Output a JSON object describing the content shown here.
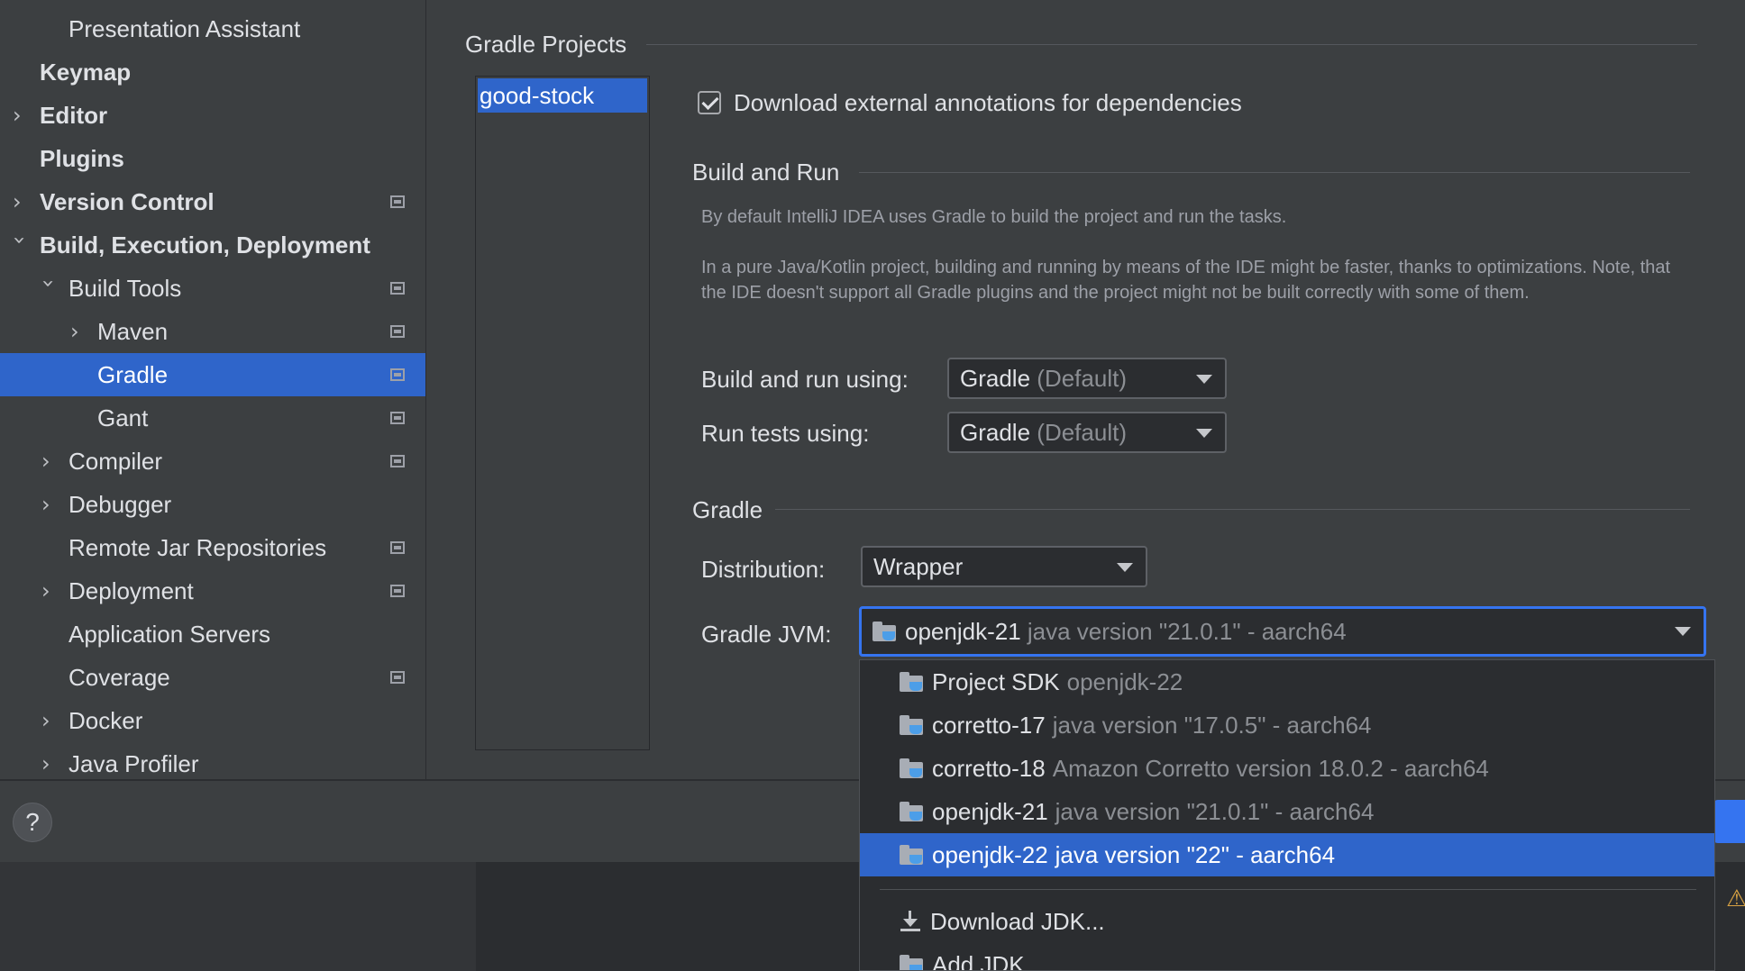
{
  "sidebar": {
    "items": [
      {
        "label": "Presentation Assistant"
      },
      {
        "label": "Keymap"
      },
      {
        "label": "Editor"
      },
      {
        "label": "Plugins"
      },
      {
        "label": "Version Control"
      },
      {
        "label": "Build, Execution, Deployment"
      },
      {
        "label": "Build Tools"
      },
      {
        "label": "Maven"
      },
      {
        "label": "Gradle"
      },
      {
        "label": "Gant"
      },
      {
        "label": "Compiler"
      },
      {
        "label": "Debugger"
      },
      {
        "label": "Remote Jar Repositories"
      },
      {
        "label": "Deployment"
      },
      {
        "label": "Application Servers"
      },
      {
        "label": "Coverage"
      },
      {
        "label": "Docker"
      },
      {
        "label": "Java Profiler"
      }
    ]
  },
  "main": {
    "gradle_projects_title": "Gradle Projects",
    "project_name": "good-stock",
    "download_annotations_label": "Download external annotations for dependencies",
    "download_annotations_checked": true,
    "build_and_run_title": "Build and Run",
    "hint1": "By default IntelliJ IDEA uses Gradle to build the project and run the tasks.",
    "hint2": "In a pure Java/Kotlin project, building and running by means of the IDE might be faster, thanks to optimizations. Note, that the IDE doesn't support all Gradle plugins and the project might not be built correctly with some of them.",
    "build_run_using_label": "Build and run using:",
    "build_run_using_value": "Gradle",
    "build_run_using_suffix": "(Default)",
    "run_tests_using_label": "Run tests using:",
    "run_tests_using_value": "Gradle",
    "run_tests_using_suffix": "(Default)",
    "gradle_title": "Gradle",
    "distribution_label": "Distribution:",
    "distribution_value": "Wrapper",
    "gradle_jvm_label": "Gradle JVM:",
    "gradle_jvm_name": "openjdk-21",
    "gradle_jvm_detail": "java version \"21.0.1\" - aarch64"
  },
  "jvm_popup": {
    "items": [
      {
        "name": "Project SDK",
        "detail": "openjdk-22"
      },
      {
        "name": "corretto-17",
        "detail": "java version \"17.0.5\" - aarch64"
      },
      {
        "name": "corretto-18",
        "detail": "Amazon Corretto version 18.0.2 - aarch64"
      },
      {
        "name": "openjdk-21",
        "detail": "java version \"21.0.1\" - aarch64"
      },
      {
        "name": "openjdk-22",
        "detail": "java version \"22\" - aarch64"
      }
    ],
    "download_jdk": "Download JDK...",
    "add_jdk": "Add JDK..."
  },
  "footer": {
    "help_label": "?"
  },
  "colors": {
    "accent": "#2f65ca",
    "focus": "#3574f0",
    "background": "#3c3f41",
    "warning": "#d9a343"
  },
  "icons": [
    "chevron-right-icon",
    "chevron-down-icon",
    "project-scope-icon",
    "checkbox-checked-icon",
    "dropdown-arrow-icon",
    "jdk-folder-icon",
    "download-icon",
    "help-icon",
    "warning-icon"
  ]
}
